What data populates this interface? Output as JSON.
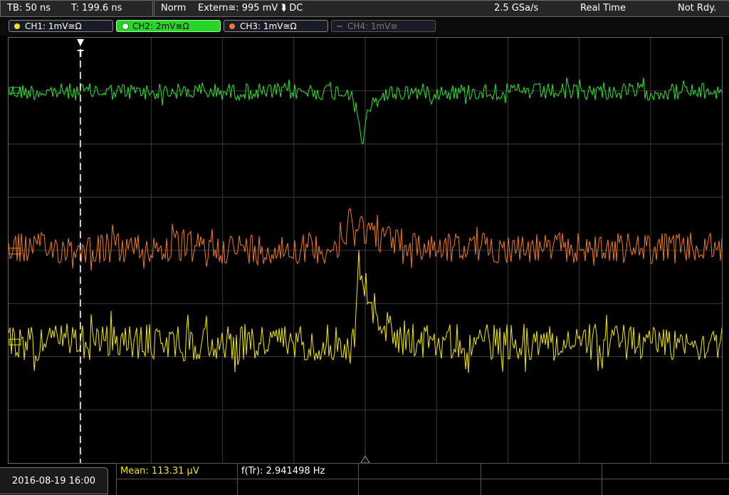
{
  "status_bar": {
    "timebase": "TB: 50 ns",
    "trigger_time": "T: 199.6 ns",
    "acq_mode": "Norm",
    "trigger_source": "Extern≅: 995 mV ⮯ DC",
    "sample_rate": "2.5 GSa/s",
    "time_mode": "Real Time",
    "trigger_status": "Not Rdy."
  },
  "channels": [
    {
      "label": "CH1: 1mV≅Ω",
      "color": "#f2e31a",
      "state": "on"
    },
    {
      "label": "CH2: 2mV≅Ω",
      "color": "#2ad52a",
      "state": "active"
    },
    {
      "label": "CH3: 1mV≅Ω",
      "color": "#f07a20",
      "state": "on"
    },
    {
      "label": "CH4: 1mV≅",
      "color": "#777777",
      "state": "off"
    }
  ],
  "trace_colors": {
    "ch1": "#f2e800",
    "ch2": "#30e030",
    "ch3": "#f07a20"
  },
  "trigger_marker": "T",
  "bottom": {
    "date": "2016-08-19 16:00",
    "mean": "Mean: 113.31 µV",
    "freq": "f(Tr): 2.941498 Hz"
  }
}
